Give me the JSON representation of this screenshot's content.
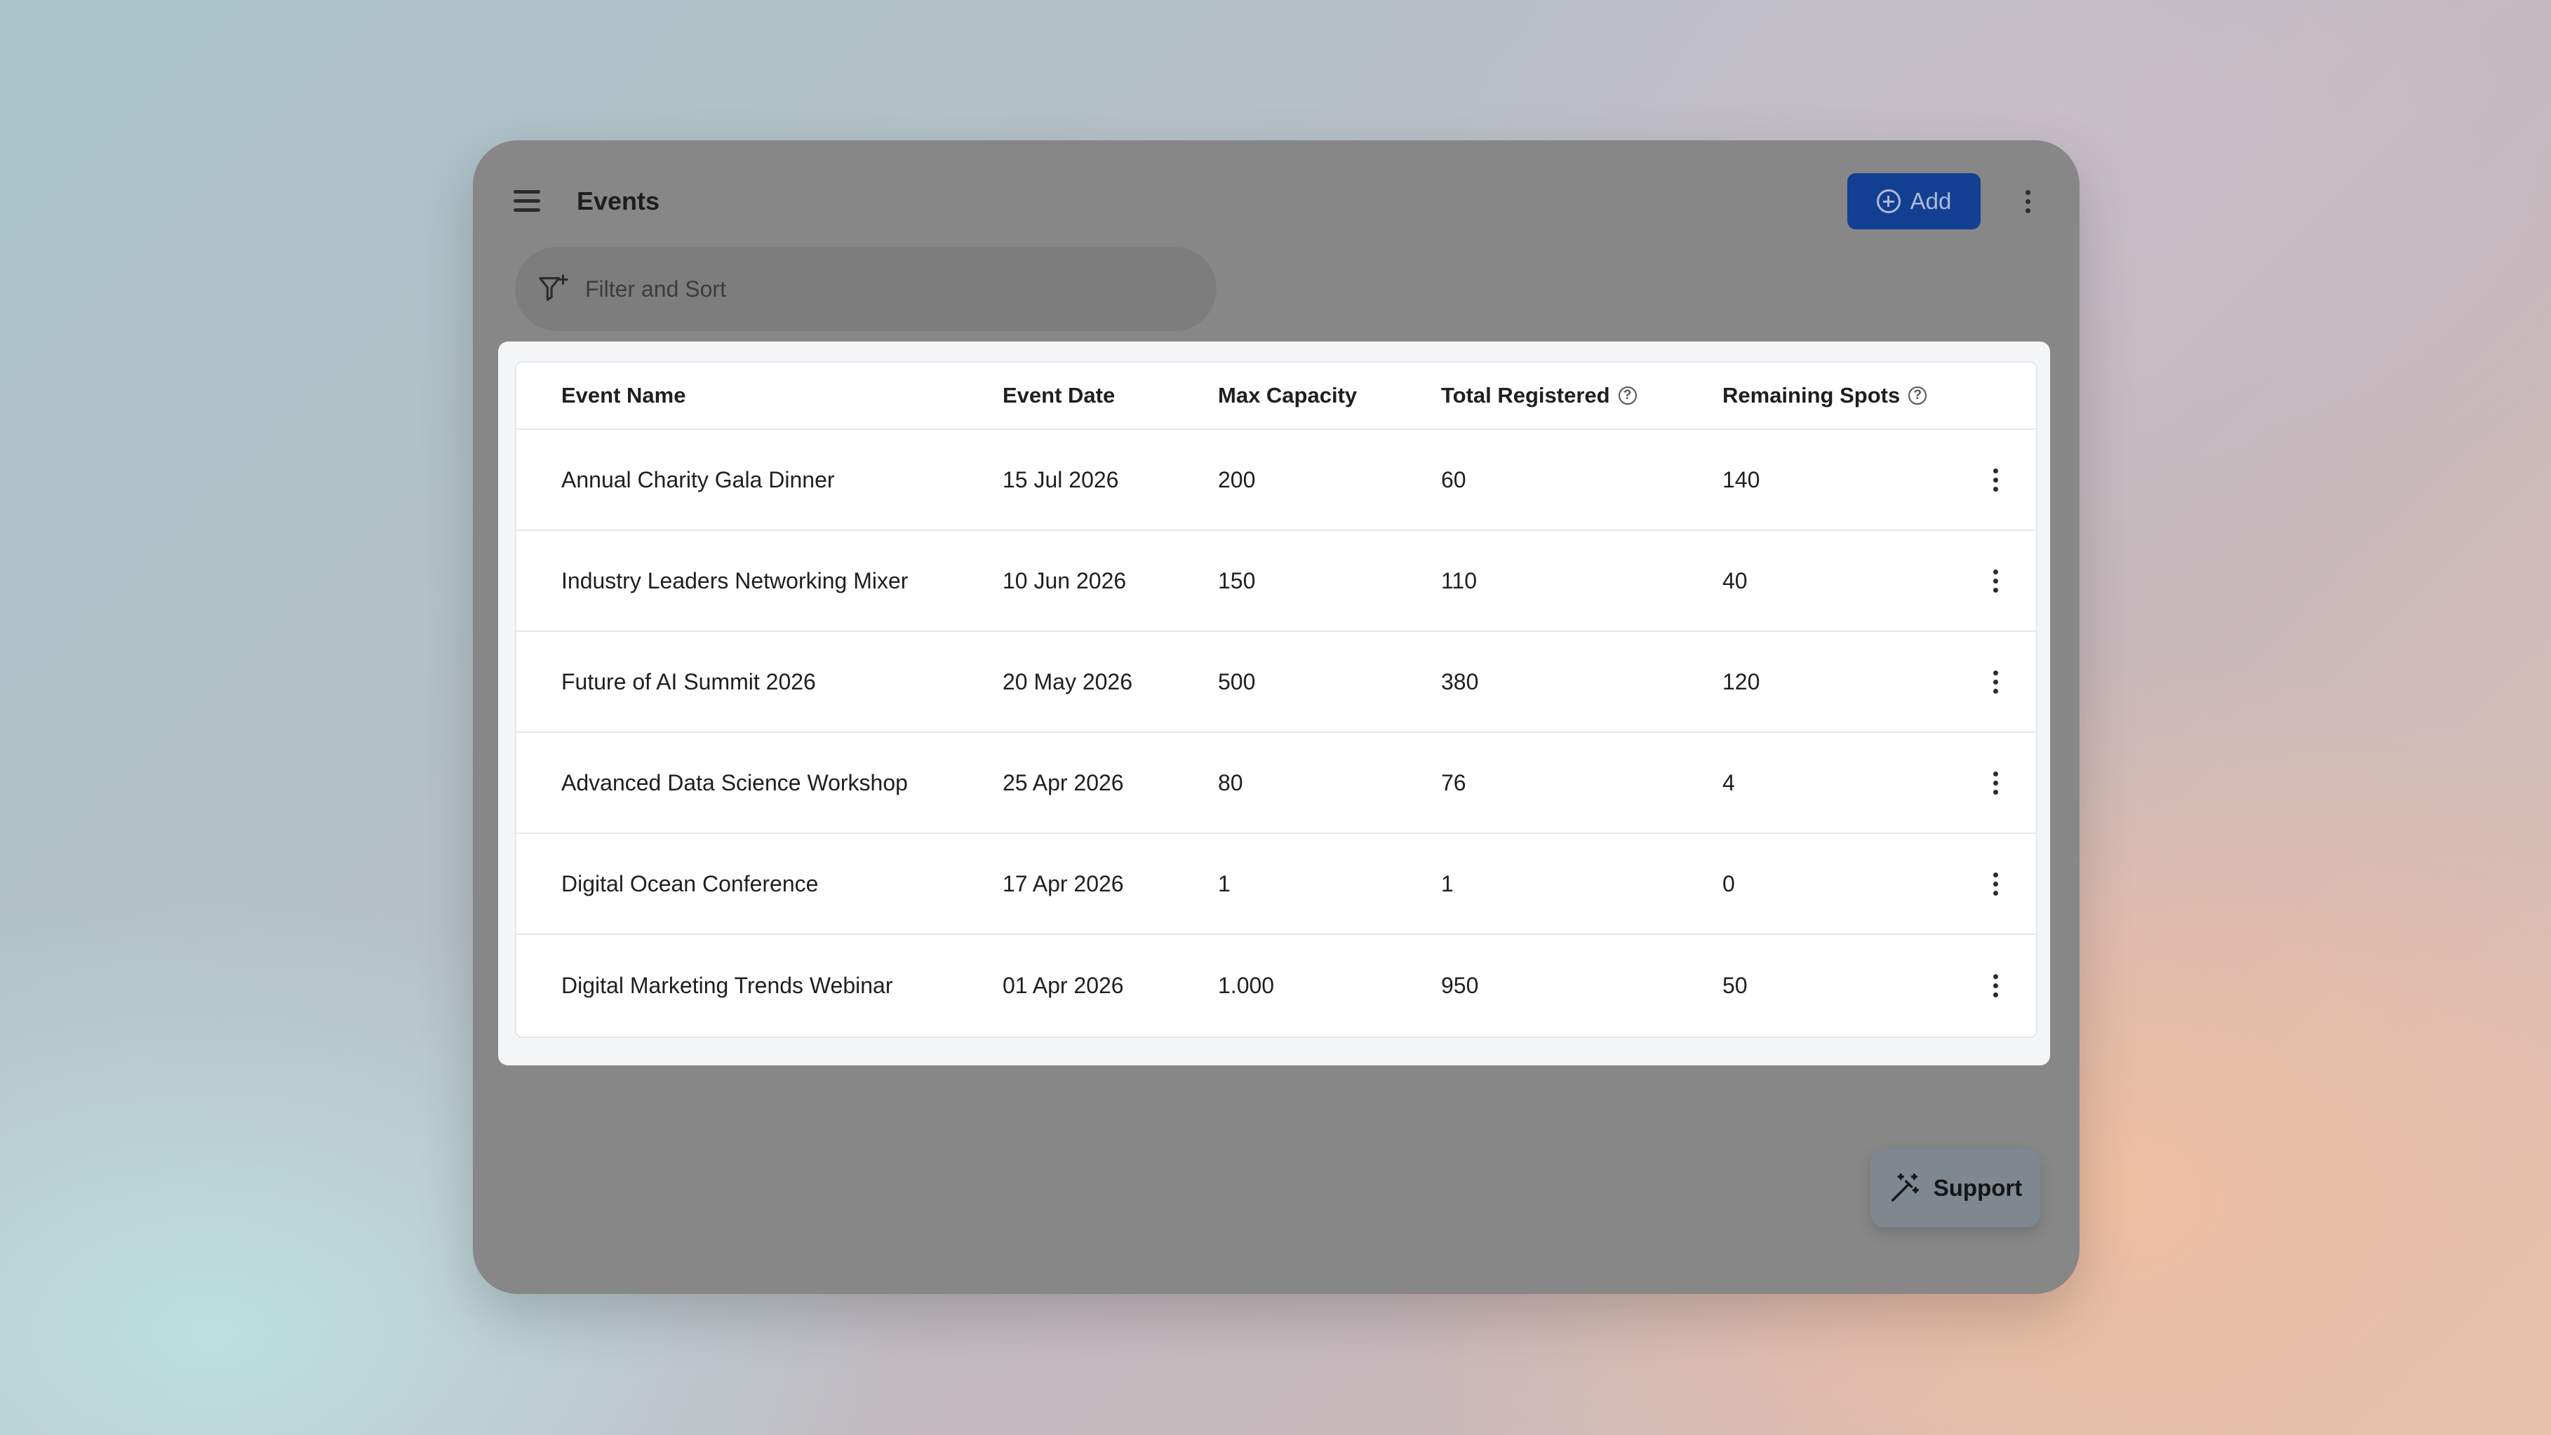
{
  "header": {
    "title": "Events",
    "add_label": "Add"
  },
  "filter": {
    "placeholder": "Filter and Sort"
  },
  "table": {
    "columns": [
      "Event Name",
      "Event Date",
      "Max Capacity",
      "Total Registered",
      "Remaining Spots"
    ],
    "rows": [
      {
        "name": "Annual Charity Gala Dinner",
        "date": "15 Jul 2026",
        "max": "200",
        "registered": "60",
        "remaining": "140"
      },
      {
        "name": "Industry Leaders Networking Mixer",
        "date": "10 Jun 2026",
        "max": "150",
        "registered": "110",
        "remaining": "40"
      },
      {
        "name": "Future of AI Summit 2026",
        "date": "20 May 2026",
        "max": "500",
        "registered": "380",
        "remaining": "120"
      },
      {
        "name": "Advanced Data Science Workshop",
        "date": "25 Apr 2026",
        "max": "80",
        "registered": "76",
        "remaining": "4"
      },
      {
        "name": "Digital Ocean Conference",
        "date": "17 Apr 2026",
        "max": "1",
        "registered": "1",
        "remaining": "0"
      },
      {
        "name": "Digital Marketing Trends Webinar",
        "date": "01 Apr 2026",
        "max": "1.000",
        "registered": "950",
        "remaining": "50"
      }
    ]
  },
  "support": {
    "label": "Support"
  },
  "colors": {
    "primary": "#133f93",
    "overlay": "#878787"
  }
}
